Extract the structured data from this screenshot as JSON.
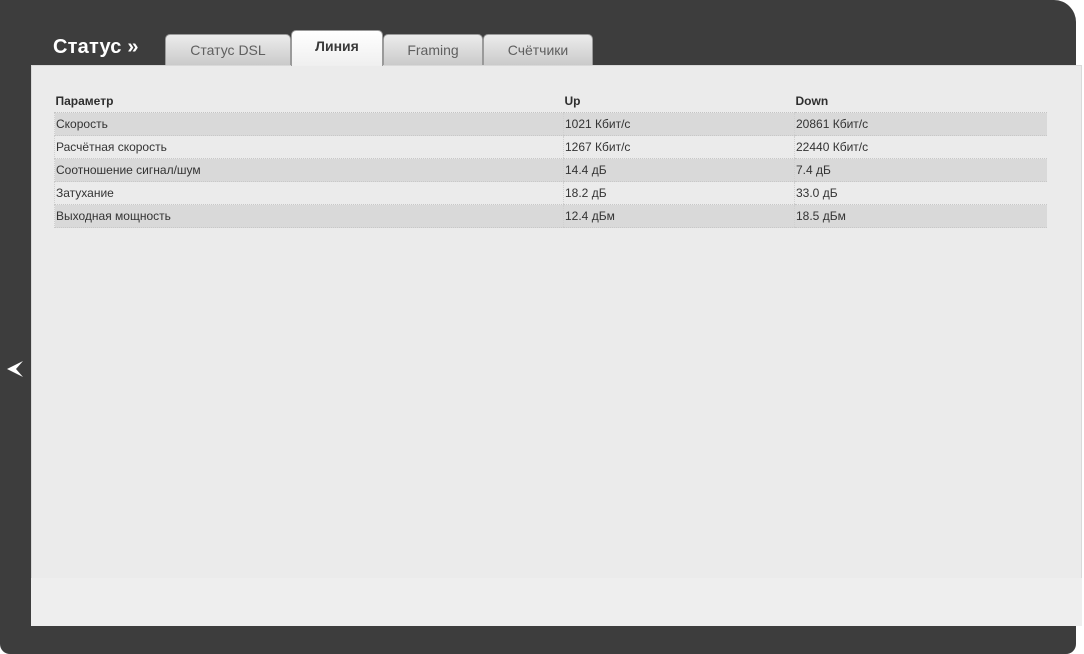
{
  "header": {
    "section_title": "Статус »"
  },
  "tabs": [
    {
      "label": "Статус DSL",
      "active": false
    },
    {
      "label": "Линия",
      "active": true
    },
    {
      "label": "Framing",
      "active": false
    },
    {
      "label": "Счётчики",
      "active": false
    }
  ],
  "table": {
    "columns": [
      "Параметр",
      "Up",
      "Down"
    ],
    "rows": [
      [
        "Скорость",
        "1021 Кбит/с",
        "20861 Кбит/с"
      ],
      [
        "Расчётная скорость",
        "1267 Кбит/с",
        "22440 Кбит/с"
      ],
      [
        "Соотношение сигнал/шум",
        "14.4 дБ",
        "7.4 дБ"
      ],
      [
        "Затухание",
        "18.2 дБ",
        "33.0 дБ"
      ],
      [
        "Выходная мощность",
        "12.4 дБм",
        "18.5 дБм"
      ]
    ]
  },
  "icons": {
    "nav_arrow": "chevron-left-icon"
  },
  "colors": {
    "frame": "#3d3d3d",
    "panel": "#ebebeb",
    "row_striped": "#d9d9d9"
  }
}
